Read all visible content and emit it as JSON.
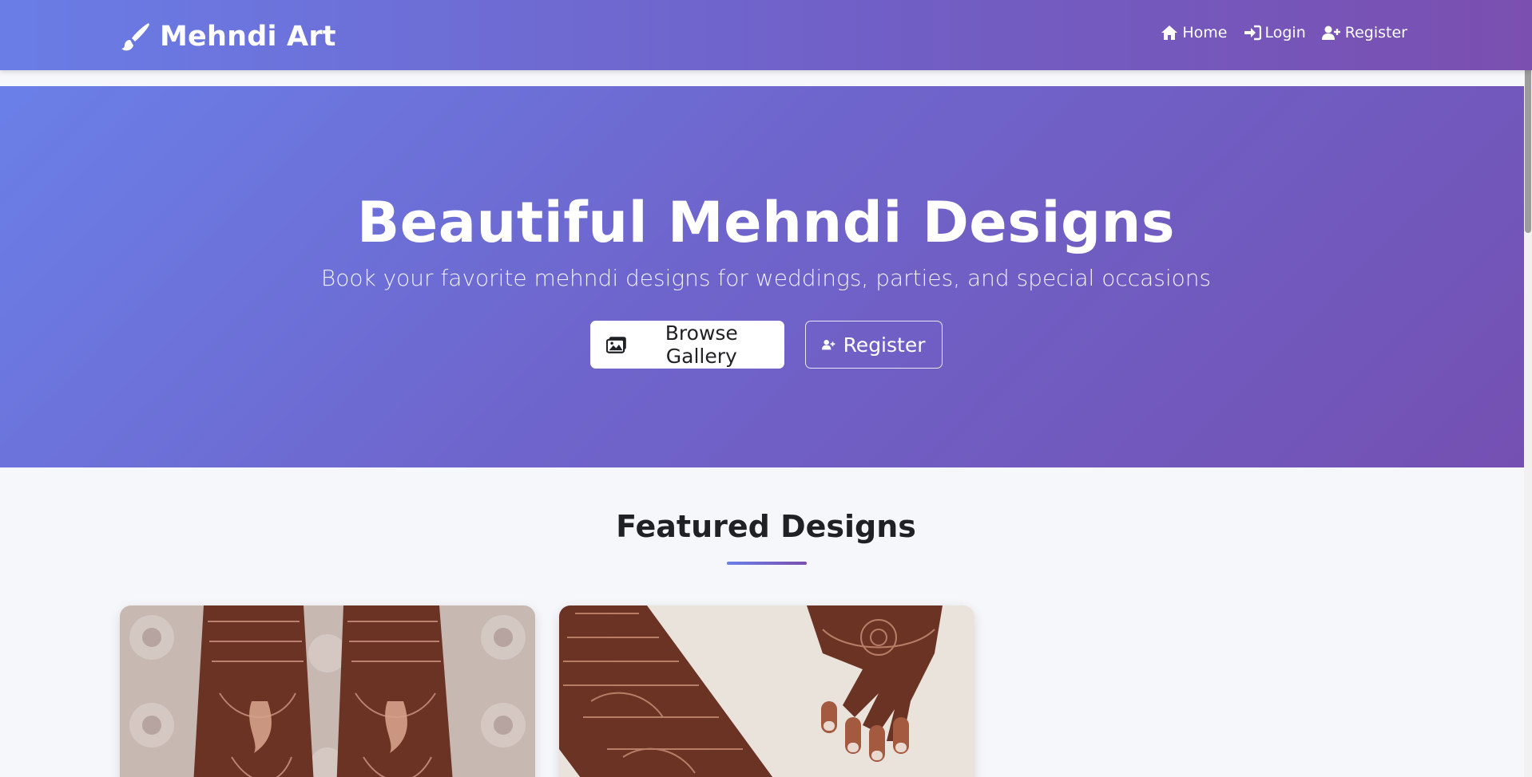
{
  "navbar": {
    "brand": "Mehndi Art",
    "brand_icon": "paint-brush-icon",
    "links": [
      {
        "label": "Home",
        "icon": "home-icon"
      },
      {
        "label": "Login",
        "icon": "sign-in-icon"
      },
      {
        "label": "Register",
        "icon": "user-plus-icon"
      }
    ]
  },
  "hero": {
    "title": "Beautiful Mehndi Designs",
    "subtitle": "Book your favorite mehndi designs for weddings, parties, and special occasions",
    "buttons": [
      {
        "label": "Browse Gallery",
        "icon": "images-icon"
      },
      {
        "label": "Register",
        "icon": "user-plus-icon"
      }
    ]
  },
  "featured": {
    "title": "Featured Designs"
  },
  "colors": {
    "gradient_start": "#6a80e8",
    "gradient_end": "#7a4fb0",
    "text_dark": "#1f2125",
    "page_bg": "#f6f7fb"
  }
}
